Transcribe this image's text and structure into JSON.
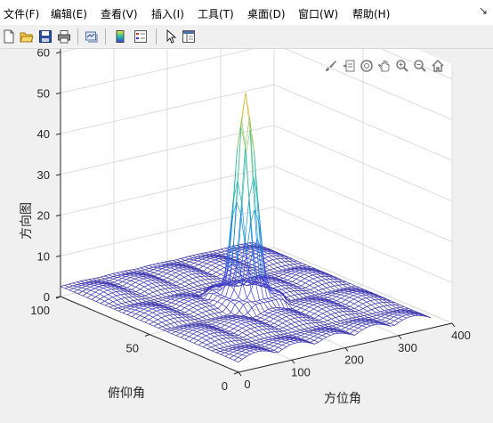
{
  "menu": {
    "items": [
      {
        "label": "文件(F)"
      },
      {
        "label": "编辑(E)"
      },
      {
        "label": "查看(V)"
      },
      {
        "label": "插入(I)"
      },
      {
        "label": "工具(T)"
      },
      {
        "label": "桌面(D)"
      },
      {
        "label": "窗口(W)"
      },
      {
        "label": "帮助(H)"
      }
    ],
    "collapse_icon": "dock-arrow-icon"
  },
  "toolbar": {
    "buttons": [
      "new-figure-icon",
      "open-icon",
      "save-icon",
      "print-icon",
      "link-plot-icon",
      "colorbar-icon",
      "legend-icon",
      "edit-plot-icon",
      "property-inspector-icon"
    ]
  },
  "axes_toolbar": {
    "buttons": [
      "brush-icon",
      "data-tips-icon",
      "rotate-3d-icon",
      "pan-icon",
      "zoom-in-icon",
      "zoom-out-icon",
      "restore-view-icon"
    ]
  },
  "chart_data": {
    "type": "surface",
    "zlabel": "方向图",
    "xlabel": "方位角",
    "ylabel": "俯仰角",
    "xlim": [
      0,
      400
    ],
    "ylim": [
      0,
      100
    ],
    "zlim": [
      0,
      60
    ],
    "x_ticks": [
      "0",
      "100",
      "200",
      "300",
      "400"
    ],
    "y_ticks": [
      "0",
      "50",
      "100"
    ],
    "z_ticks": [
      "0",
      "10",
      "20",
      "30",
      "40",
      "50",
      "60"
    ],
    "peak": {
      "x": 180,
      "y": 50,
      "z": 60
    },
    "colormap": "parula",
    "grid": true
  }
}
